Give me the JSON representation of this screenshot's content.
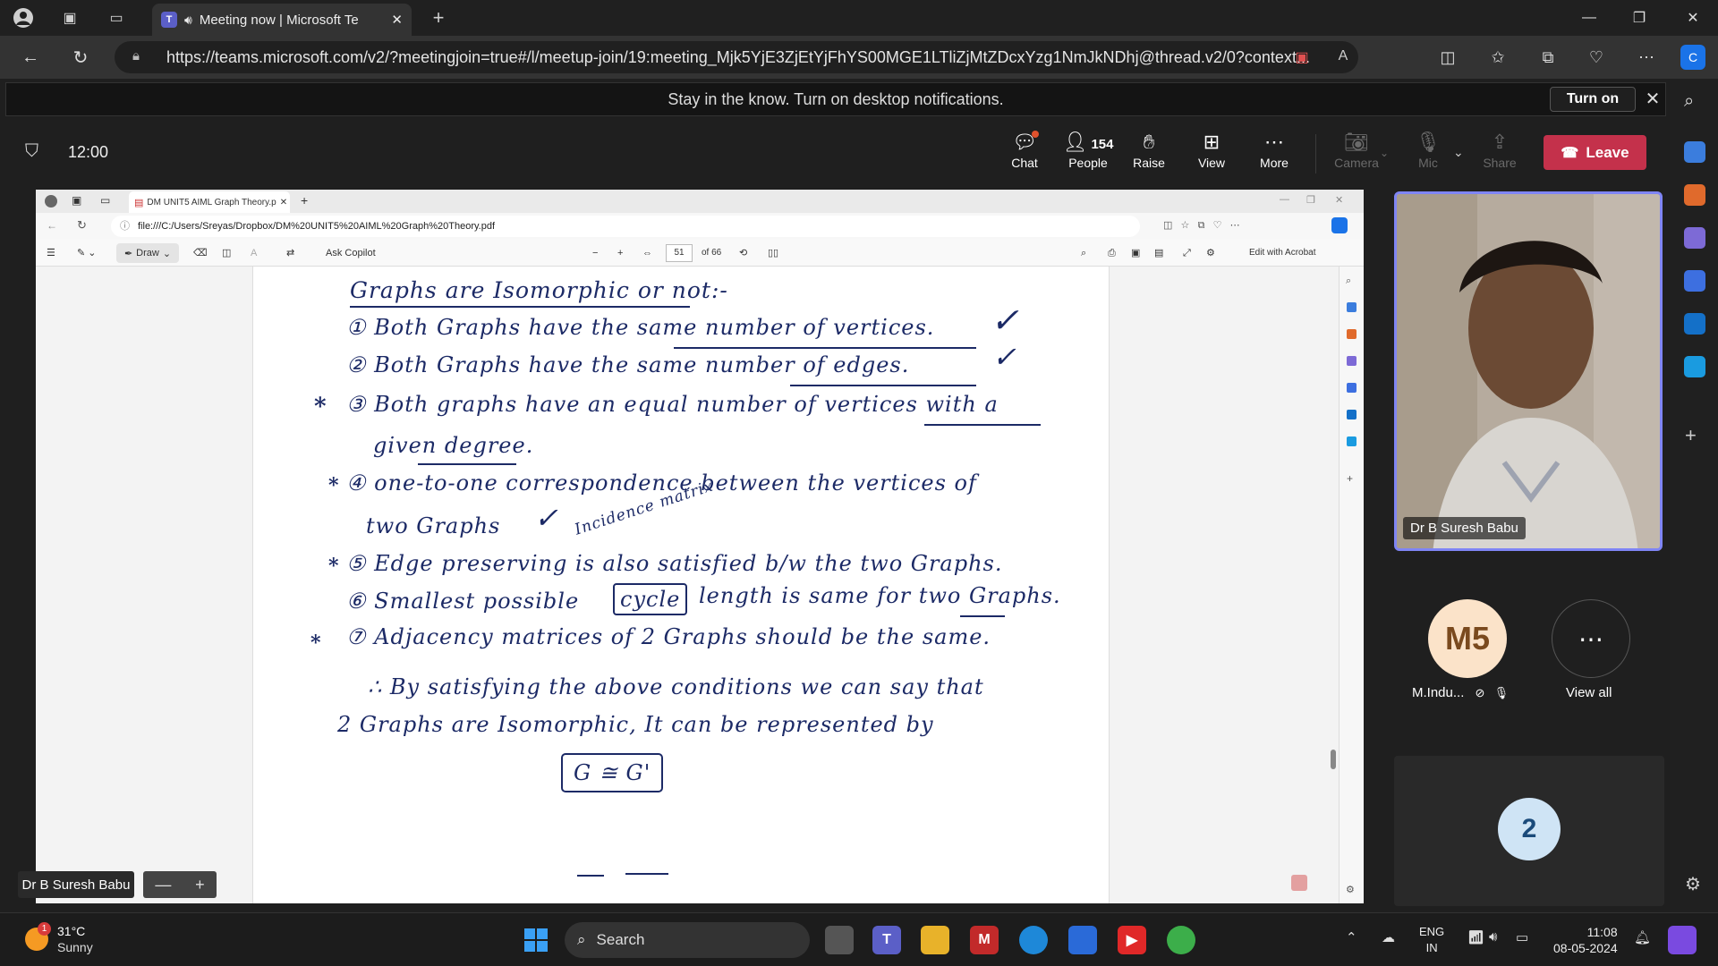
{
  "browser": {
    "tab_title": "Meeting now | Microsoft Te",
    "url": "https://teams.microsoft.com/v2/?meetingjoin=true#/l/meetup-join/19:meeting_Mjk5YjE3ZjEtYjFhYS00MGE1LTliZjMtZDcxYzg1NmJkNDhj@thread.v2/0?context...",
    "new_tab": "+"
  },
  "notification": {
    "text": "Stay in the know. Turn on desktop notifications.",
    "turn_on": "Turn on"
  },
  "meeting": {
    "timer": "12:00",
    "chat": "Chat",
    "people_count": "154",
    "people": "People",
    "raise": "Raise",
    "view": "View",
    "more": "More",
    "camera": "Camera",
    "mic": "Mic",
    "share": "Share",
    "leave": "Leave"
  },
  "shared_screen": {
    "inner_tab_title": "DM UNIT5 AIML Graph Theory.p",
    "inner_url": "file:///C:/Users/Sreyas/Dropbox/DM%20UNIT5%20AIML%20Graph%20Theory.pdf",
    "draw": "Draw",
    "ask_copilot": "Ask Copilot",
    "page_number": "51",
    "page_total": "of 66",
    "edit_acrobat": "Edit with Acrobat",
    "presenter": "Dr B Suresh Babu",
    "zoom_minus": "—",
    "zoom_plus": "+",
    "handwriting": {
      "heading": "Graphs are Isomorphic or not:-",
      "line1": "① Both Graphs have the same number of vertices.",
      "line2": "② Both Graphs have the same number of edges.",
      "line3a": "③ Both graphs have an equal number of vertices with a",
      "line3b": "given degree.",
      "line4a": "④ one-to-one correspondence between the vertices of",
      "line4b": "two Graphs",
      "annotation": "Incidence matrix",
      "line5": "⑤ Edge preserving is also satisfied b/w the two Graphs.",
      "line6_pre": "⑥ Smallest possible",
      "line6_box": "cycle",
      "line6_post": "length is same for two Graphs.",
      "line7": "⑦ Adjacency matrices of 2 Graphs should be the same.",
      "concl1": "∴ By satisfying the above conditions we can say that",
      "concl2": "2 Graphs are Isomorphic, It can be represented by",
      "formula": "G ≅ G'",
      "star": "*",
      "check": "✓"
    }
  },
  "participants": {
    "video_name": "Dr B Suresh Babu",
    "m5_initials": "M5",
    "m5_name": "M.Indu...",
    "view_all": "View all",
    "view_all_icon": "⋯",
    "overflow_count": "2"
  },
  "taskbar": {
    "temp": "31°C",
    "weather": "Sunny",
    "weather_badge": "1",
    "search": "Search",
    "lang1": "ENG",
    "lang2": "IN",
    "time": "11:08",
    "date": "08-05-2024"
  }
}
